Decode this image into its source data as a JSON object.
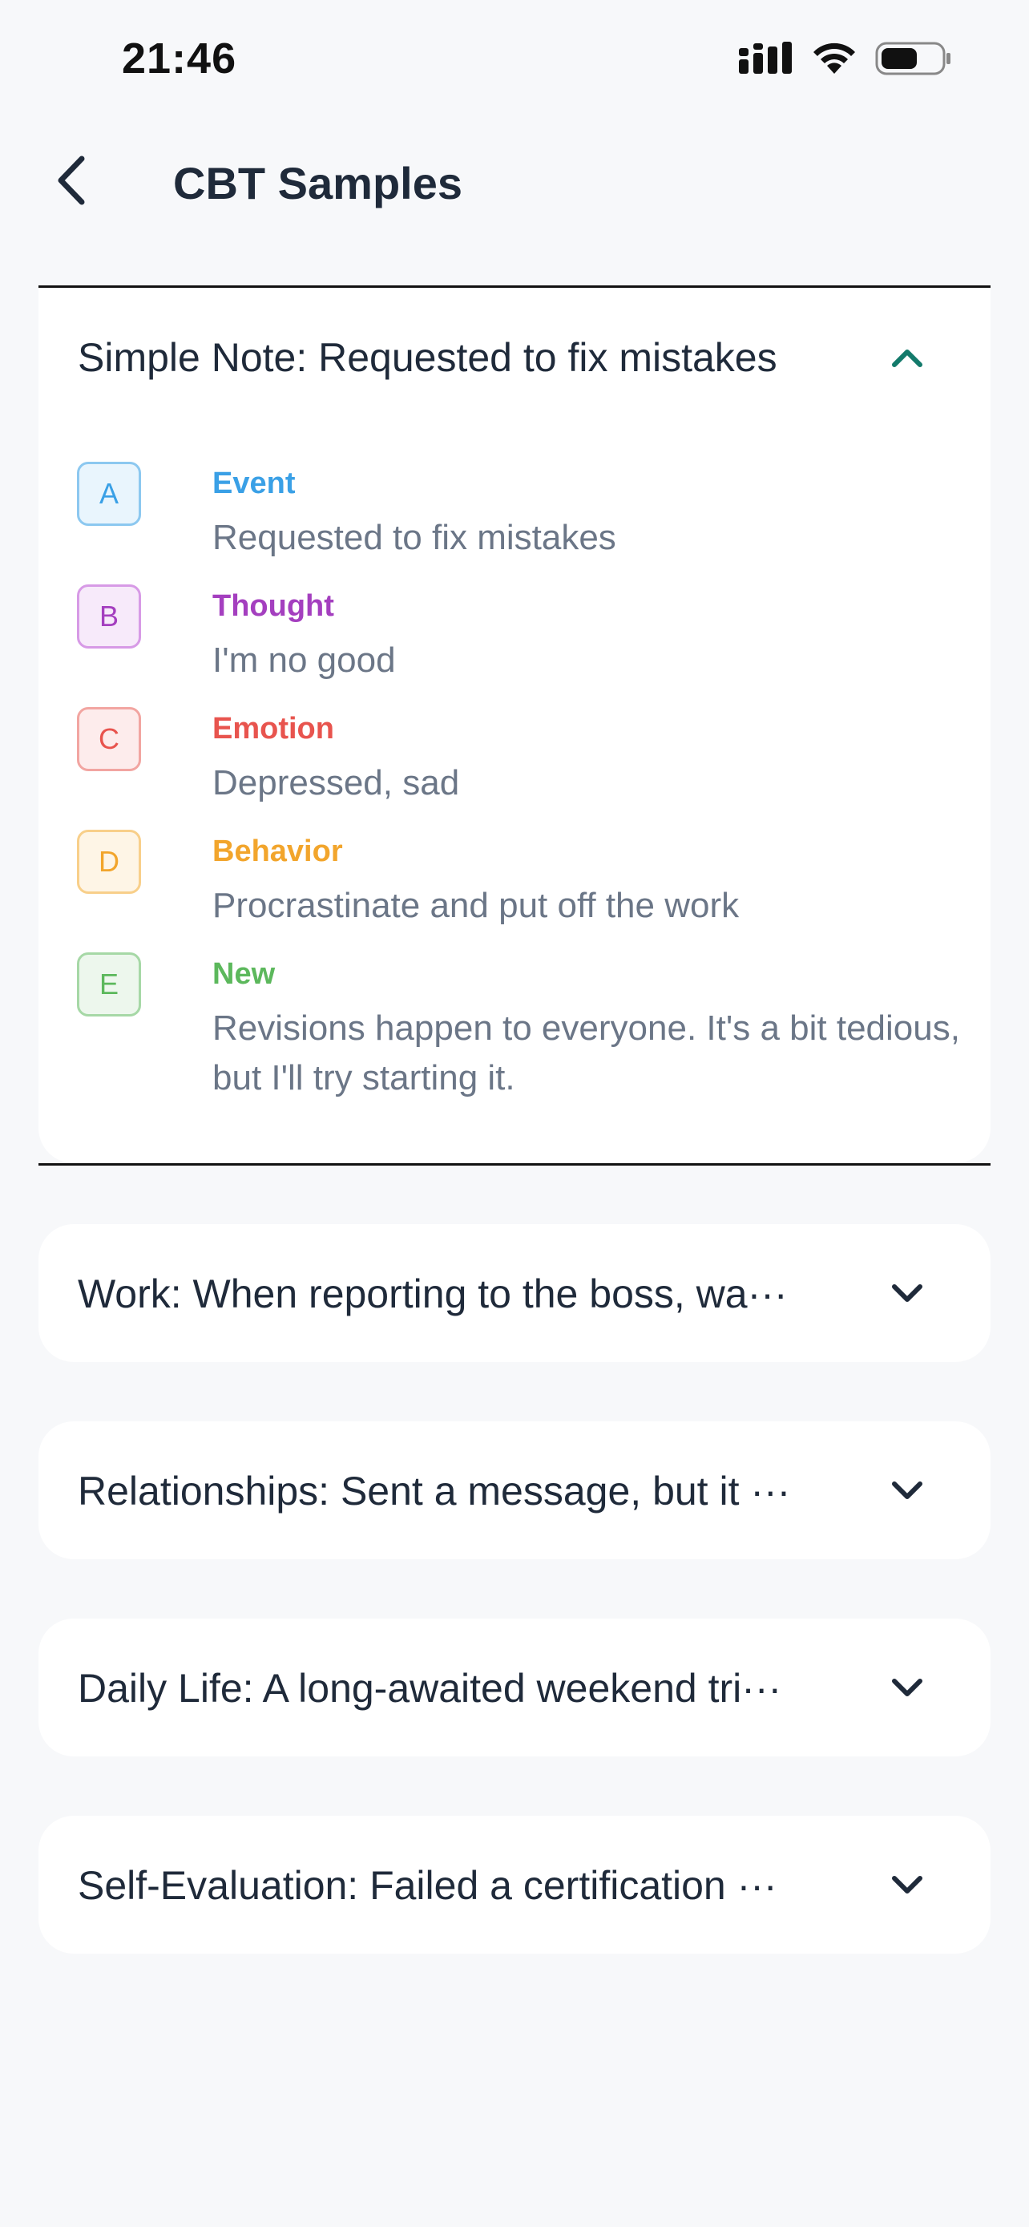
{
  "status_bar": {
    "time": "21:46",
    "icons": [
      "signal-icon",
      "wifi-icon",
      "battery-icon"
    ]
  },
  "header": {
    "title": "CBT Samples",
    "back_icon": "chevron-left-icon"
  },
  "colors": {
    "event": "#3aa0e6",
    "thought": "#a43fbf",
    "emotion": "#e8544e",
    "behavior": "#f2a52c",
    "new": "#5cb85c",
    "accent": "#137a6b"
  },
  "expanded_card": {
    "title": "Simple Note: Requested to fix mistakes",
    "rows": [
      {
        "letter": "A",
        "label": "Event",
        "value": "Requested to fix mistakes"
      },
      {
        "letter": "B",
        "label": "Thought",
        "value": "I'm no good"
      },
      {
        "letter": "C",
        "label": "Emotion",
        "value": "Depressed, sad"
      },
      {
        "letter": "D",
        "label": "Behavior",
        "value": "Procrastinate and put off the work"
      },
      {
        "letter": "E",
        "label": "New",
        "value": "Revisions happen to everyone. It's a bit tedious, but I'll try starting it."
      }
    ]
  },
  "collapsed_cards": [
    {
      "title": "Work: When reporting to the boss, wa···"
    },
    {
      "title": "Relationships: Sent a message, but it ···"
    },
    {
      "title": "Daily Life: A long-awaited weekend tri···"
    },
    {
      "title": "Self-Evaluation: Failed a certification ···"
    }
  ]
}
